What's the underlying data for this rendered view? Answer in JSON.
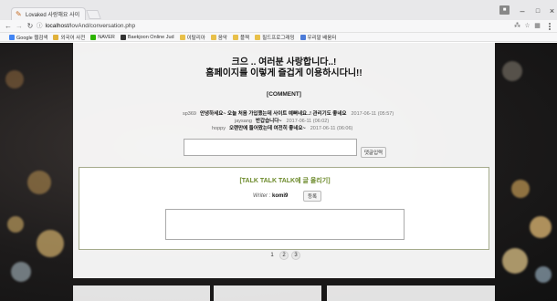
{
  "browser": {
    "tab_title": "Lovaked 사랑해요 사이 ×",
    "url_host": "localhost",
    "url_path": "/lovAnd/conversation.php",
    "info_icon": "info-icon",
    "bookmarks": [
      {
        "label": "Google 웹검색",
        "color": "#4285f4"
      },
      {
        "label": "외국어 사전",
        "color": "#e0b13a"
      },
      {
        "label": "NAVER",
        "color": "#2db400"
      },
      {
        "label": "Baekjoon Online Jud",
        "color": "#333333"
      },
      {
        "label": "이탈리아",
        "color": "#e8c04a"
      },
      {
        "label": "음악",
        "color": "#e8c04a"
      },
      {
        "label": "플젝",
        "color": "#e8c04a"
      },
      {
        "label": "필드프로그래밍",
        "color": "#e8c04a"
      },
      {
        "label": "우리말 배움터",
        "color": "#4c7bd8"
      }
    ]
  },
  "page": {
    "headline_line1": "크으 .. 여러분 사랑합니다..!",
    "headline_line2": "홈페이지를 이렇게 즐겁게 이용하시다니!!",
    "comment_header": "[COMMENT]",
    "comments": [
      {
        "user": "sp369",
        "message": "안녕하세요~ 오늘 처음 가입했는데 사이트 예뻐네요..! 관리기도 좋네요",
        "date": "2017-06-11 (05:57)"
      },
      {
        "user": "jaysang",
        "message": "반갑습니다~",
        "date": "2017-06-11 (06:02)"
      },
      {
        "user": "hoppy",
        "message": "오랜만에 들어왔는데 여전히 좋네요~",
        "date": "2017-06-11 (06:06)"
      }
    ],
    "comment_submit": "댓글입력",
    "talk_title": "[TALK TALK TALK에 글 올리기]",
    "writer_label": "Writer :",
    "writer_name": "komi9",
    "register_button": "등록",
    "pages": [
      "1",
      "2",
      "3"
    ]
  }
}
